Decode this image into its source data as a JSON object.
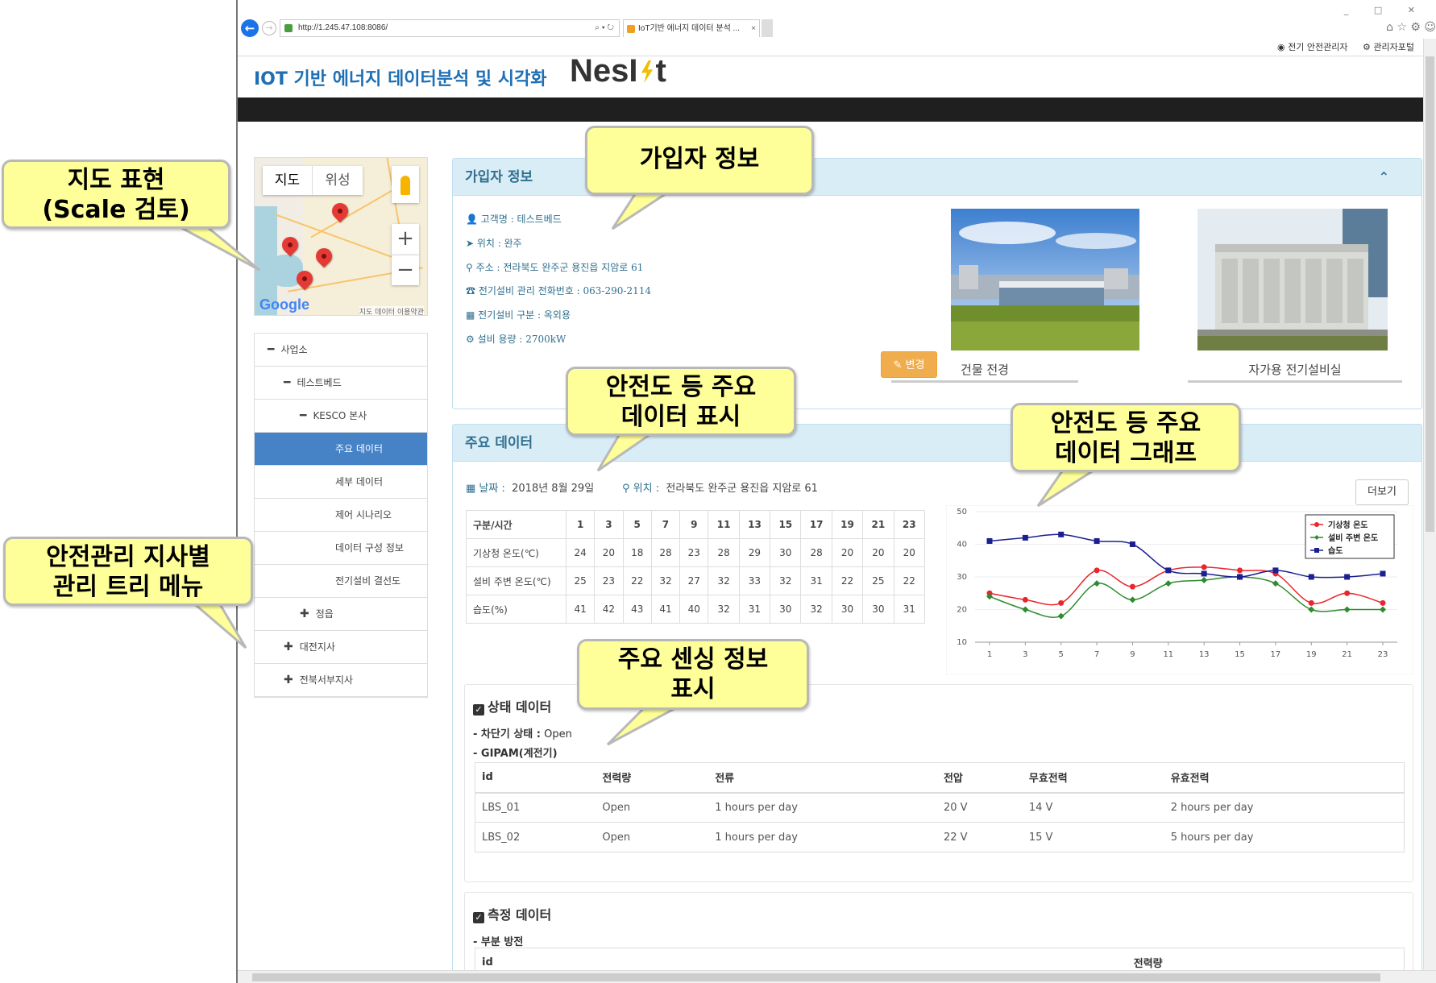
{
  "browser": {
    "url": "http://1.245.47.108:8086/",
    "tab_title": "IoT기반 에너지 데이터 분석 ...",
    "window_controls": "_ □ ✕",
    "toolbar_icons": "⌂ ☆ ⚙ ☺",
    "user_link": "전기 안전관리자",
    "portal_link": "관리자포털"
  },
  "header": {
    "title": "IOT 기반 에너지 데이터분석 및 시각화",
    "logo_a": "NesI",
    "logo_b": "t"
  },
  "map": {
    "type_map": "지도",
    "type_satellite": "위성",
    "zoom_in": "+",
    "zoom_out": "−",
    "google": "Google",
    "footer": "지도 데이터   이용약관"
  },
  "tree": {
    "items": [
      {
        "label": "사업소",
        "sym": "━",
        "indent": 0
      },
      {
        "label": "테스트베드",
        "sym": "━",
        "indent": 1
      },
      {
        "label": "KESCO 본사",
        "sym": "━",
        "indent": 2
      },
      {
        "label": "주요 데이터",
        "sym": "",
        "indent": 3,
        "active": true
      },
      {
        "label": "세부 데이터",
        "sym": "",
        "indent": 3
      },
      {
        "label": "제어 시나리오",
        "sym": "",
        "indent": 3
      },
      {
        "label": "데이터 구성 정보",
        "sym": "",
        "indent": 3
      },
      {
        "label": "전기설비 결선도",
        "sym": "",
        "indent": 3
      },
      {
        "label": "정읍",
        "sym": "✚",
        "indent": 2
      },
      {
        "label": "대전지사",
        "sym": "✚",
        "indent": 1
      },
      {
        "label": "전북서부지사",
        "sym": "✚",
        "indent": 1
      }
    ]
  },
  "subscriber": {
    "heading": "가입자 정보",
    "collapse": "⌃",
    "customer": "고객명 : 테스트베드",
    "location": "위치 : 완주",
    "address": "주소 : 전라북도 완주군 용진읍 지암로 61",
    "phone": "전기설비 관리 전화번호 : 063-290-2114",
    "category": "전기설비 구분 : 옥외용",
    "capacity": "설비 용량 : 2700kW",
    "edit": "✎ 변경",
    "photo1_caption": "건물 전경",
    "photo2_caption": "자가용 전기설비실"
  },
  "main_data": {
    "heading": "주요 데이터",
    "date_label": "날짜 :",
    "date_value": "2018년 8월 29일",
    "loc_label": "위치 :",
    "loc_value": "전라북도 완주군 용진읍 지암로 61",
    "more": "더보기",
    "table_header": [
      "구분/시간",
      "1",
      "3",
      "5",
      "7",
      "9",
      "11",
      "13",
      "15",
      "17",
      "19",
      "21",
      "23"
    ],
    "table_rows": [
      [
        "기상청 온도(℃)",
        "24",
        "20",
        "18",
        "28",
        "23",
        "28",
        "29",
        "30",
        "28",
        "20",
        "20",
        "20"
      ],
      [
        "설비 주변 온도(℃)",
        "25",
        "23",
        "22",
        "32",
        "27",
        "32",
        "33",
        "32",
        "31",
        "22",
        "25",
        "22"
      ],
      [
        "습도(%)",
        "41",
        "42",
        "43",
        "41",
        "40",
        "32",
        "31",
        "30",
        "32",
        "30",
        "30",
        "31"
      ]
    ]
  },
  "chart_data": {
    "type": "line",
    "x": [
      1,
      3,
      5,
      7,
      9,
      11,
      13,
      15,
      17,
      19,
      21,
      23
    ],
    "ylim": [
      10,
      50
    ],
    "yticks": [
      10,
      20,
      30,
      40,
      50
    ],
    "legend_position": "top-right",
    "series": [
      {
        "name": "기상청 온도",
        "color": "#e8262c",
        "marker": "circle",
        "values": [
          25,
          23,
          22,
          32,
          27,
          32,
          33,
          32,
          31,
          22,
          25,
          22
        ]
      },
      {
        "name": "설비 주변 온도",
        "color": "#2e8b2e",
        "marker": "diamond",
        "values": [
          24,
          20,
          18,
          28,
          23,
          28,
          29,
          30,
          28,
          20,
          20,
          20
        ]
      },
      {
        "name": "습도",
        "color": "#1b1f8f",
        "marker": "square",
        "values": [
          41,
          42,
          43,
          41,
          40,
          32,
          31,
          30,
          32,
          30,
          30,
          31
        ]
      }
    ]
  },
  "status": {
    "heading": "상태 데이터",
    "breaker_label": "- 차단기 상태 :",
    "breaker_value": "Open",
    "gipam": "- GIPAM(계전기)",
    "columns": [
      "id",
      "전력량",
      "전류",
      "전압",
      "무효전력",
      "유효전력"
    ],
    "rows": [
      [
        "LBS_01",
        "Open",
        "1 hours per day",
        "20 V",
        "14 V",
        "2 hours per day"
      ],
      [
        "LBS_02",
        "Open",
        "1 hours per day",
        "22 V",
        "15 V",
        "5 hours per day"
      ]
    ]
  },
  "measure": {
    "heading": "측정 데이터",
    "sub": "- 부분 방전",
    "columns": [
      "id",
      "전력량"
    ]
  },
  "callouts": {
    "map": "지도 표현\n(Scale 검토)",
    "tree": "안전관리 지사별\n관리 트리 메뉴",
    "subscriber": "가입자 정보",
    "main_data": "안전도 등 주요\n데이터 표시",
    "graph": "안전도 등 주요\n데이터 그래프",
    "sensing": "주요 센싱 정보\n표시"
  }
}
